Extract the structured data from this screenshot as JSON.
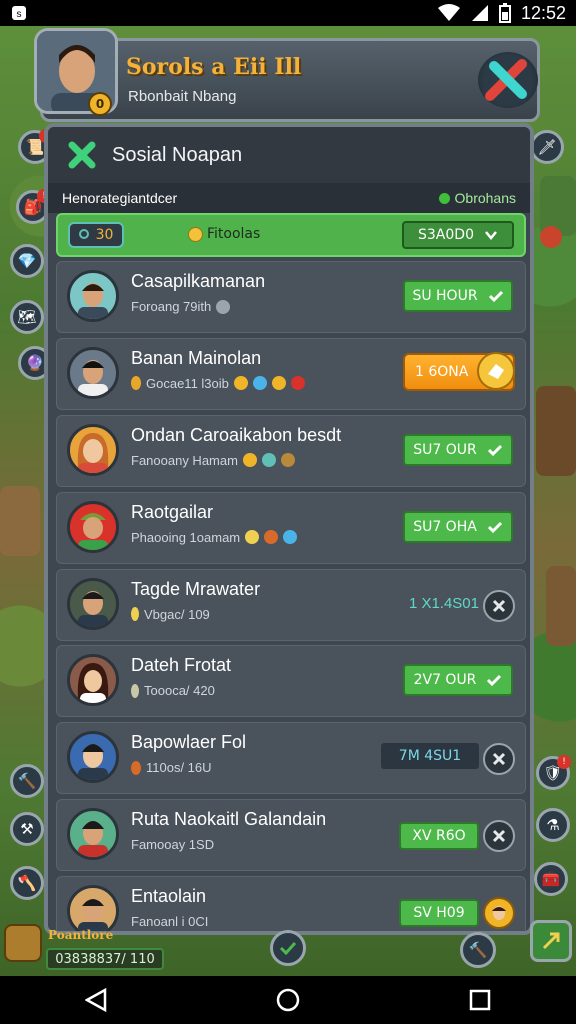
{
  "status_bar": {
    "time": "12:52"
  },
  "header": {
    "game_title": "Sorols a Eii Ill",
    "subtitle": "Rbonbait Nbang",
    "level": "0"
  },
  "panel": {
    "title": "Sosial Noapan",
    "subheader_left": "Henorategiantdcer",
    "online_label": "Obrohans"
  },
  "filter": {
    "count": "30",
    "label": "Fitoolas",
    "dropdown_value": "S3A0D0"
  },
  "friends": [
    {
      "name": "Casapilkamanan",
      "sub": "Foroang 79ith",
      "action": "SU HOUR",
      "action_type": "green"
    },
    {
      "name": "Banan Mainolan",
      "sub": "Gocae11 l3oib",
      "action": "1 6ONA",
      "action_type": "orange"
    },
    {
      "name": "Ondan Caroaikabon besdt",
      "sub": "Fanooany Hamam",
      "action": "SU7 OUR",
      "action_type": "green"
    },
    {
      "name": "Raotgailar",
      "sub": "Phaooing 1oamam",
      "action": "SU7 OHA",
      "action_type": "green"
    },
    {
      "name": "Tagde Mrawater",
      "sub": "Vbgac/ 109",
      "action": "1 X1.4S01",
      "action_type": "pending"
    },
    {
      "name": "Dateh Frotat",
      "sub": "Toooca/ 420",
      "action": "2V7 OUR",
      "action_type": "green"
    },
    {
      "name": "Bapowlaer Fol",
      "sub": "110os/ 16U",
      "action": "7M 4SU1",
      "action_type": "pending-box"
    },
    {
      "name": "Ruta Naokaitl Galandain",
      "sub": "Famooay 1SD",
      "action": "XV R6O",
      "action_type": "green-x"
    },
    {
      "name": "Entaolain",
      "sub": "Fanoanl i 0CI",
      "action": "SV H09",
      "action_type": "green-avatar"
    }
  ],
  "bottom": {
    "bar_text": "03838837/ 110",
    "label": "Poantlore"
  },
  "colors": {
    "accent_green": "#4db94a",
    "accent_orange": "#f08e10",
    "panel_bg": "#3e4650"
  }
}
